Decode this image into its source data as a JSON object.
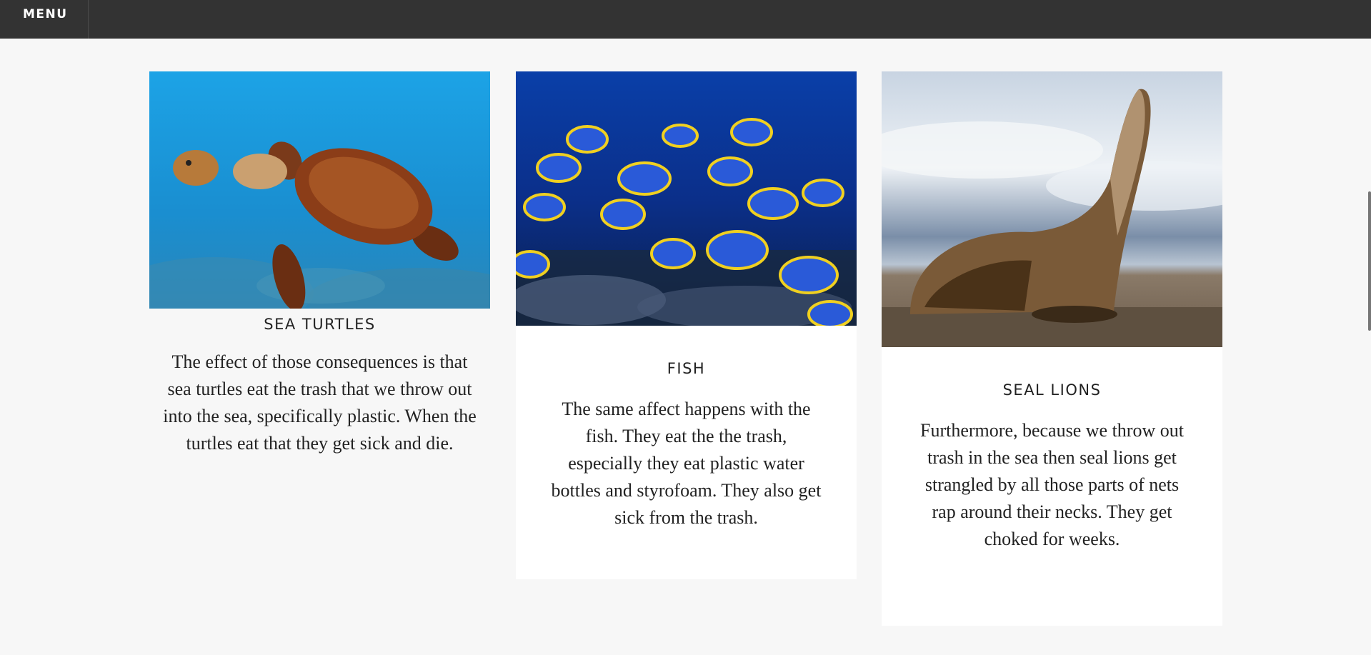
{
  "header": {
    "menu_label": "MENU"
  },
  "cards": [
    {
      "title": "SEA TURTLES",
      "body": "The effect of those consequences is that sea turtles eat the trash that we throw out into the sea, specifically plastic. When the turtles eat that they get sick and die.",
      "image": "sea-turtle-photo"
    },
    {
      "title": "FISH",
      "body": "The same affect happens with the fish. They eat the the trash, especially they eat plastic water bottles and  styrofoam. They also get sick from the trash.",
      "image": "fish-school-photo"
    },
    {
      "title": "SEAL LIONS",
      "body": "Furthermore, because we throw out trash in the sea then seal lions get strangled by all those parts of nets rap around their necks. They get choked for weeks.",
      "image": "sea-lion-photo"
    }
  ],
  "colors": {
    "topbar": "#333333",
    "page_background": "#f7f7f7",
    "card_background": "#ffffff",
    "text": "#222222"
  }
}
